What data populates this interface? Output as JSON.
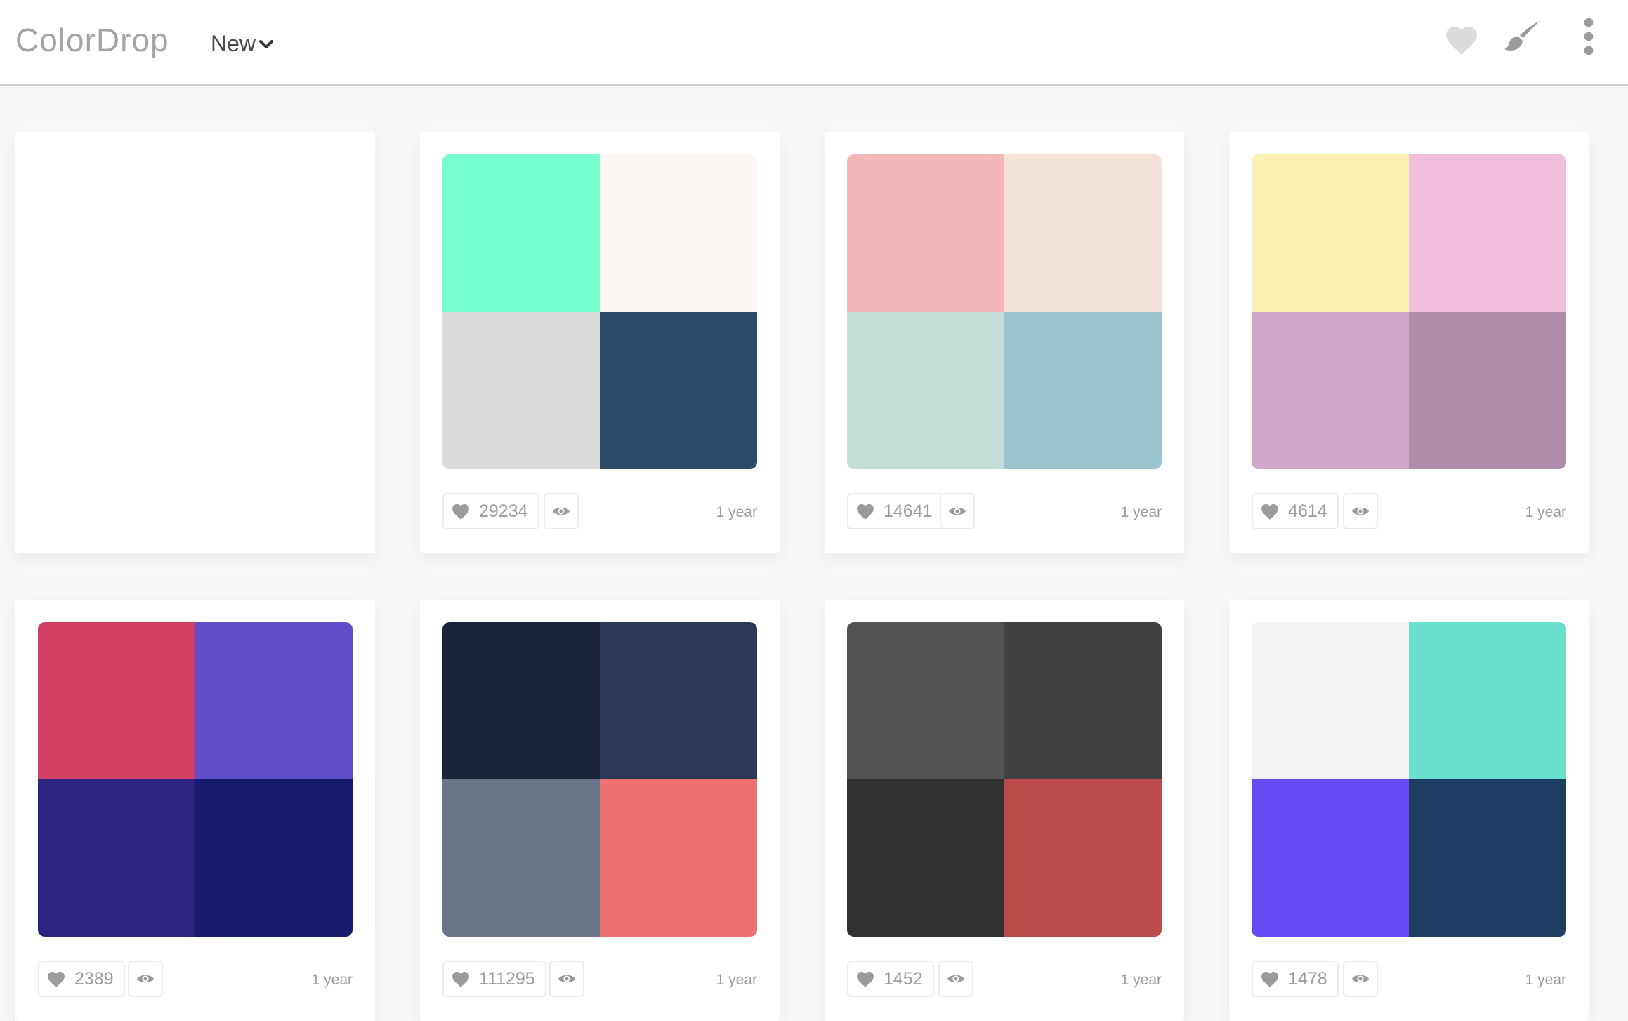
{
  "header": {
    "logo": "ColorDrop",
    "sort_label": "New",
    "icons": [
      "heart-icon",
      "brush-icon",
      "more-vertical-icon"
    ],
    "icon_color": "#9b9b9b"
  },
  "palettes": [
    {
      "empty": true
    },
    {
      "colors": [
        "#77ffd0",
        "#fcf6f5",
        "#dadada",
        "#2b4a68"
      ],
      "likes": "29234",
      "age": "1 year"
    },
    {
      "colors": [
        "#f3b7b9",
        "#f5e3d9",
        "#c3ded7",
        "#99c4d0"
      ],
      "likes": "14641",
      "age": "1 year"
    },
    {
      "colors": [
        "#fcf1b2",
        "#f0bfdb",
        "#cea7cb",
        "#b08bac"
      ],
      "likes": "4614",
      "age": "1 year"
    },
    {
      "colors": [
        "#d13f64",
        "#614ecb",
        "#2d2481",
        "#161b6d"
      ],
      "likes": "2389",
      "age": "1 year"
    },
    {
      "colors": [
        "#1b223b",
        "#2b3756",
        "#6b7588",
        "#ed7170"
      ],
      "likes": "111295",
      "age": "1 year"
    },
    {
      "colors": [
        "#535353",
        "#414141",
        "#313131",
        "#bb4a4b"
      ],
      "likes": "1452",
      "age": "1 year"
    },
    {
      "colors": [
        "#f2f3f5",
        "#69e0cd",
        "#684bf4",
        "#1d3d63"
      ],
      "likes": "1478",
      "age": "1 year"
    }
  ]
}
